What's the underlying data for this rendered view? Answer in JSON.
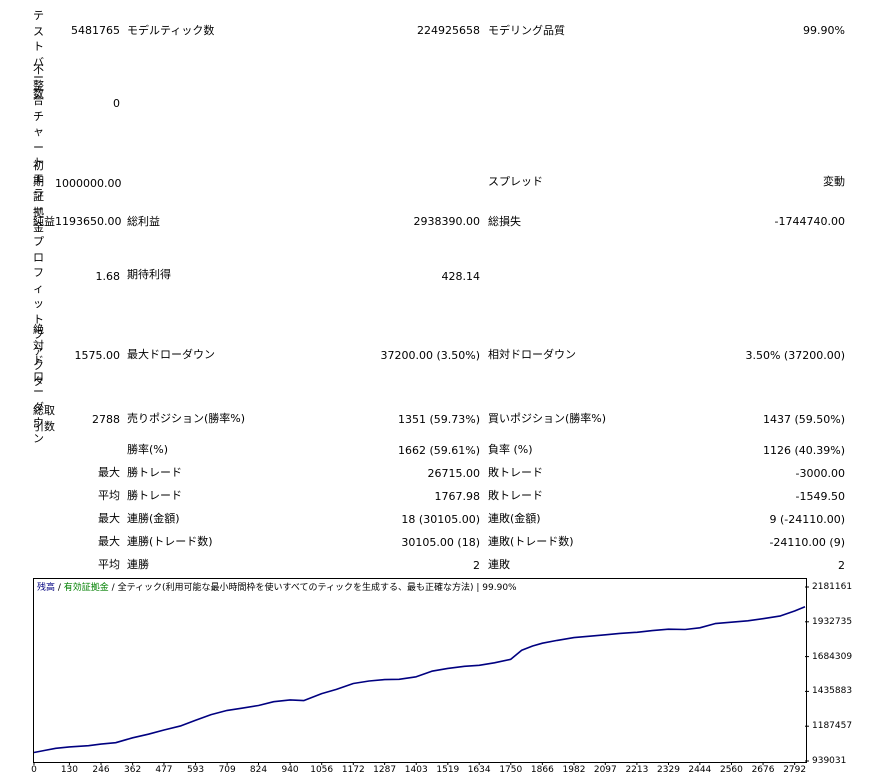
{
  "report": {
    "test_bars_label": "テストバー数",
    "test_bars_value": "5481765",
    "model_ticks_label": "モデルティック数",
    "model_ticks_value": "224925658",
    "model_quality_label": "モデリング品質",
    "model_quality_value": "99.90%",
    "mismatch_label": "不整合チャートエラー",
    "mismatch_value": "0",
    "initial_deposit_label": "初期証拠金",
    "initial_deposit_value": "1000000.00",
    "spread_label": "スプレッド",
    "spread_value": "変動",
    "net_profit_label": "純益",
    "net_profit_value": "1193650.00",
    "gross_profit_label": "総利益",
    "gross_profit_value": "2938390.00",
    "gross_loss_label": "総損失",
    "gross_loss_value": "-1744740.00",
    "profit_factor_label": "プロフィットファクタ",
    "profit_factor_value": "1.68",
    "expected_payoff_label": "期待利得",
    "expected_payoff_value": "428.14",
    "abs_dd_label": "絶対ドローダウン",
    "abs_dd_value": "1575.00",
    "max_dd_label": "最大ドローダウン",
    "max_dd_value": "37200.00 (3.50%)",
    "rel_dd_label": "相対ドローダウン",
    "rel_dd_value": "3.50% (37200.00)",
    "total_trades_label": "総取引数",
    "total_trades_value": "2788",
    "short_label": "売りポジション(勝率%)",
    "short_value": "1351 (59.73%)",
    "long_label": "買いポジション(勝率%)",
    "long_value": "1437 (59.50%)",
    "win_rate_label": "勝率(%)",
    "win_rate_value": "1662 (59.61%)",
    "loss_rate_label": "負率 (%)",
    "loss_rate_value": "1126 (40.39%)",
    "largest_label": "最大",
    "largest_win_label": "勝トレード",
    "largest_win_value": "26715.00",
    "largest_loss_label": "敗トレード",
    "largest_loss_value": "-3000.00",
    "average_label": "平均",
    "average_win_label": "勝トレード",
    "average_win_value": "1767.98",
    "average_loss_label": "敗トレード",
    "average_loss_value": "-1549.50",
    "max_consec_label": "最大",
    "max_consec_wins_label": "連勝(金額)",
    "max_consec_wins_value": "18 (30105.00)",
    "max_consec_losses_label": "連敗(金額)",
    "max_consec_losses_value": "9 (-24110.00)",
    "max_consec2_label": "最大",
    "max_consec_profit_label": "連勝(トレード数)",
    "max_consec_profit_value": "30105.00 (18)",
    "max_consec_loss_label": "連敗(トレード数)",
    "max_consec_loss_value": "-24110.00 (9)",
    "avg_consec_label": "平均",
    "avg_consec_wins_label": "連勝",
    "avg_consec_wins_value": "2",
    "avg_consec_losses_label": "連敗",
    "avg_consec_losses_value": "2"
  },
  "chart": {
    "legend_balance": "残高",
    "legend_sep1": " / ",
    "legend_equity": "有効証拠金",
    "legend_sep2": " / ",
    "legend_model": "全ティック(利用可能な最小時間枠を使いすべてのティックを生成する、最も正確な方法)",
    "legend_sep3": " | ",
    "legend_quality": "99.90%",
    "balance_color": "#000080",
    "equity_color": "#008000",
    "legend_text_color": "#000000"
  },
  "chart_data": {
    "type": "line",
    "title": "",
    "xlabel": "",
    "ylabel": "",
    "x_ticks": [
      "0",
      "130",
      "246",
      "362",
      "477",
      "593",
      "709",
      "824",
      "940",
      "1056",
      "1172",
      "1287",
      "1403",
      "1519",
      "1634",
      "1750",
      "1866",
      "1982",
      "2097",
      "2213",
      "2329",
      "2444",
      "2560",
      "2676",
      "2792"
    ],
    "y_ticks": [
      "2181161",
      "1932735",
      "1684309",
      "1435883",
      "1187457",
      "939031"
    ],
    "xlim": [
      0,
      2830
    ],
    "ylim": [
      939031,
      2181161
    ],
    "grid": false,
    "series": [
      {
        "values_x": [
          0,
          40,
          80,
          130,
          200,
          246,
          300,
          362,
          420,
          477,
          540,
          593,
          650,
          709,
          760,
          824,
          880,
          940,
          990,
          1056,
          1110,
          1172,
          1230,
          1287,
          1340,
          1403,
          1460,
          1519,
          1580,
          1634,
          1690,
          1750,
          1790,
          1830,
          1866,
          1920,
          1982,
          2040,
          2097,
          2150,
          2213,
          2270,
          2329,
          2390,
          2444,
          2500,
          2560,
          2620,
          2676,
          2740,
          2792,
          2830
        ],
        "values_y": [
          1000000,
          1015000,
          1030000,
          1040000,
          1048000,
          1060000,
          1070000,
          1105000,
          1130000,
          1160000,
          1190000,
          1230000,
          1270000,
          1300000,
          1315000,
          1335000,
          1362000,
          1375000,
          1370000,
          1420000,
          1450000,
          1492000,
          1510000,
          1520000,
          1522000,
          1540000,
          1580000,
          1600000,
          1615000,
          1622000,
          1640000,
          1665000,
          1730000,
          1760000,
          1780000,
          1800000,
          1820000,
          1830000,
          1840000,
          1850000,
          1858000,
          1870000,
          1880000,
          1878000,
          1890000,
          1920000,
          1930000,
          1940000,
          1955000,
          1975000,
          2010000,
          2040000
        ]
      }
    ]
  }
}
